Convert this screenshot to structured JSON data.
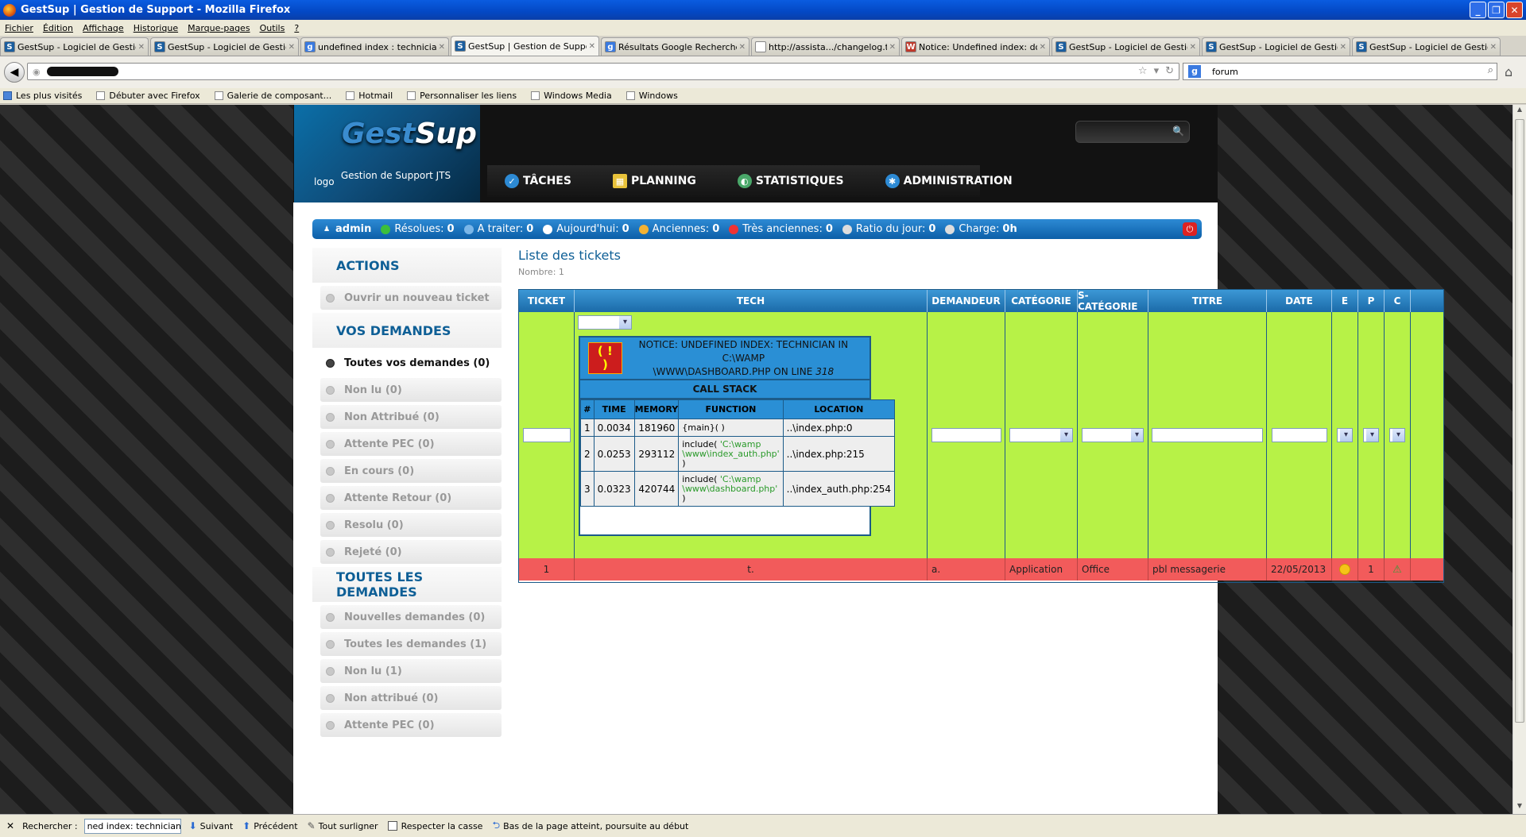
{
  "window": {
    "title": "GestSup | Gestion de Support - Mozilla Firefox"
  },
  "menu": [
    "Fichier",
    "Édition",
    "Affichage",
    "Historique",
    "Marque-pages",
    "Outils",
    "?"
  ],
  "tabs": [
    {
      "label": "GestSup - Logiciel de Gestio...",
      "icon": "S",
      "color": "#1b5e9e"
    },
    {
      "label": "GestSup - Logiciel de Gestio...",
      "icon": "S",
      "color": "#1b5e9e"
    },
    {
      "label": "undefined index : technician...",
      "icon": "g",
      "color": "#3a7ae0"
    },
    {
      "label": "GestSup | Gestion de Support",
      "icon": "S",
      "color": "#1b5e9e",
      "active": true
    },
    {
      "label": "Résultats Google Recherche...",
      "icon": "g",
      "color": "#3a7ae0"
    },
    {
      "label": "http://assista.../changelog.txt",
      "icon": "",
      "color": "#ffffff"
    },
    {
      "label": "Notice: Undefined index: do...",
      "icon": "W",
      "color": "#c0392b"
    },
    {
      "label": "GestSup - Logiciel de Gestio...",
      "icon": "S",
      "color": "#1b5e9e"
    },
    {
      "label": "GestSup - Logiciel de Gestio...",
      "icon": "S",
      "color": "#1b5e9e"
    },
    {
      "label": "GestSup - Logiciel de Gestio...",
      "icon": "S",
      "color": "#1b5e9e"
    }
  ],
  "search": {
    "value": "forum"
  },
  "bookmarks": [
    "Les plus visités",
    "Débuter avec Firefox",
    "Galerie de composant...",
    "Hotmail",
    "Personnaliser les liens",
    "Windows Media",
    "Windows"
  ],
  "site": {
    "logo_gest": "Gest",
    "logo_sup": "Sup",
    "logo_alt": "logo",
    "subtitle": "Gestion de Support JTS",
    "nav": [
      {
        "label": "TÂCHES",
        "icon": "check-circle-icon",
        "color": "#2d8ad4"
      },
      {
        "label": "PLANNING",
        "icon": "calendar-icon",
        "color": "#e8c23a"
      },
      {
        "label": "STATISTIQUES",
        "icon": "globe-chart-icon",
        "color": "#4aa86a"
      },
      {
        "label": "ADMINISTRATION",
        "icon": "tools-icon",
        "color": "#2d8ad4"
      }
    ]
  },
  "status": {
    "user": "admin",
    "items": [
      {
        "label": "Résolues:",
        "value": "0",
        "color": "#3cbf3c"
      },
      {
        "label": "A traiter:",
        "value": "0",
        "color": "#7ab6e8"
      },
      {
        "label": "Aujourd'hui:",
        "value": "0",
        "color": "#ffffff"
      },
      {
        "label": "Anciennes:",
        "value": "0",
        "color": "#f2b233"
      },
      {
        "label": "Très anciennes:",
        "value": "0",
        "color": "#e33"
      },
      {
        "label": "Ratio du jour:",
        "value": "0",
        "color": "#ddd"
      },
      {
        "label": "Charge:",
        "value": "0h",
        "color": "#ddd"
      }
    ]
  },
  "sidebar": {
    "actions_title": "ACTIONS",
    "actions": [
      "Ouvrir un nouveau ticket"
    ],
    "vos_title": "VOS DEMANDES",
    "vos": [
      "Toutes vos demandes (0)",
      "Non lu (0)",
      "Non Attribué (0)",
      "Attente PEC (0)",
      "En cours (0)",
      "Attente Retour (0)",
      "Resolu (0)",
      "Rejeté (0)"
    ],
    "toutes_title": "TOUTES LES DEMANDES",
    "toutes": [
      "Nouvelles demandes (0)",
      "Toutes les demandes (1)",
      "Non lu (1)",
      "Non attribué (0)",
      "Attente PEC (0)"
    ]
  },
  "list": {
    "title": "Liste des tickets",
    "count": "Nombre: 1"
  },
  "table": {
    "headers": [
      "TICKET",
      "TECH",
      "DEMANDEUR",
      "CATÉGORIE",
      "S-CATÉGORIE",
      "TITRE",
      "DATE",
      "E",
      "P",
      "C"
    ],
    "row": {
      "ticket": "1",
      "tech": "t.",
      "demandeur": "a.",
      "categorie": "Application",
      "scategorie": "Office",
      "titre": "pbl messagerie",
      "date": "22/05/2013",
      "p": "1"
    }
  },
  "notice": {
    "badge": "( ! )",
    "line1": "NOTICE: UNDEFINED INDEX: TECHNICIAN IN C:\\WAMP",
    "line2": "\\WWW\\DASHBOARD.PHP ON LINE",
    "line_no": "318",
    "callstack": "CALL STACK",
    "cols": [
      "#",
      "TIME",
      "MEMORY",
      "FUNCTION",
      "LOCATION"
    ],
    "rows": [
      {
        "n": "1",
        "time": "0.0034",
        "mem": "181960",
        "fn": "{main}( )",
        "fn_path": "",
        "fn_end": "",
        "loc": "..\\index.php:0"
      },
      {
        "n": "2",
        "time": "0.0253",
        "mem": "293112",
        "fn": "include( ",
        "fn_path": "'C:\\wamp \\www\\index_auth.php'",
        "fn_end": ")",
        "loc": "..\\index.php:215"
      },
      {
        "n": "3",
        "time": "0.0323",
        "mem": "420744",
        "fn": "include( ",
        "fn_path": "'C:\\wamp \\www\\dashboard.php'",
        "fn_end": ")",
        "loc": "..\\index_auth.php:254"
      }
    ]
  },
  "findbar": {
    "label": "Rechercher :",
    "value": "ned index: technician in",
    "next": "Suivant",
    "prev": "Précédent",
    "highlight": "Tout surligner",
    "case": "Respecter la casse",
    "message": "Bas de la page atteint, poursuite au début"
  }
}
